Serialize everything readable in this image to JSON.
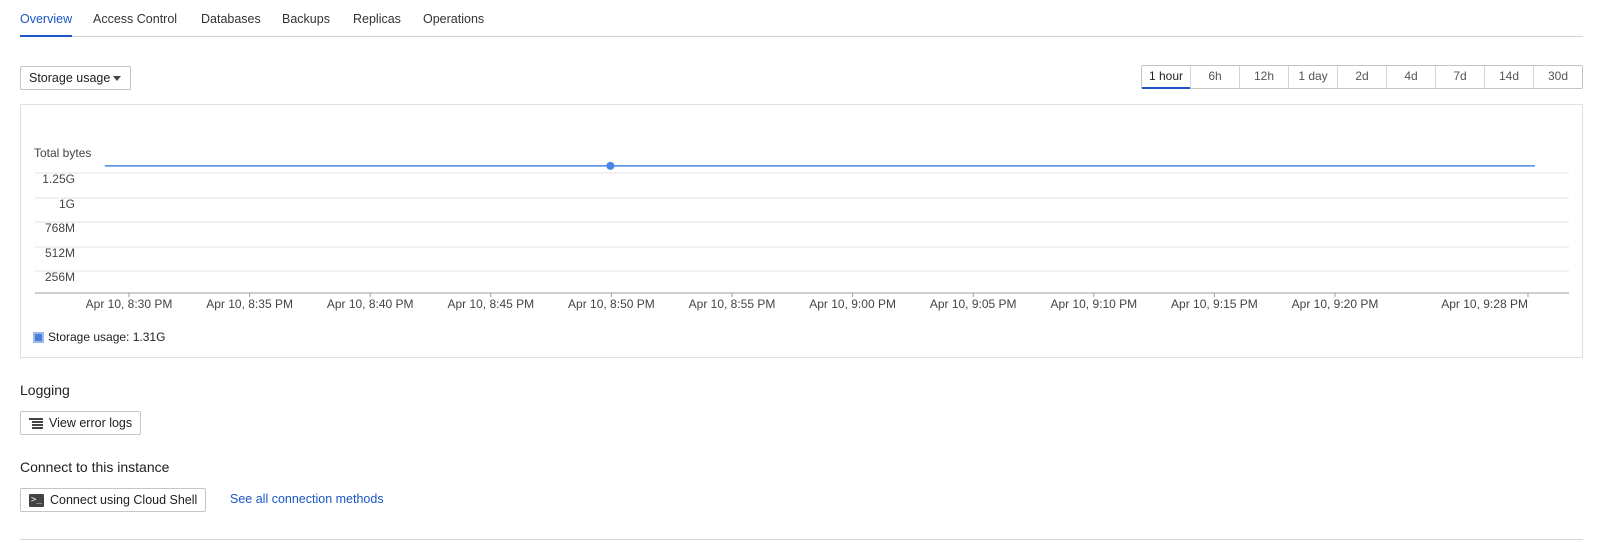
{
  "tabs": [
    {
      "label": "Overview",
      "active": true
    },
    {
      "label": "Access Control",
      "active": false
    },
    {
      "label": "Databases",
      "active": false
    },
    {
      "label": "Backups",
      "active": false
    },
    {
      "label": "Replicas",
      "active": false
    },
    {
      "label": "Operations",
      "active": false
    }
  ],
  "metric_select": {
    "value": "Storage usage"
  },
  "time_ranges": [
    {
      "label": "1 hour",
      "active": true
    },
    {
      "label": "6h",
      "active": false
    },
    {
      "label": "12h",
      "active": false
    },
    {
      "label": "1 day",
      "active": false
    },
    {
      "label": "2d",
      "active": false
    },
    {
      "label": "4d",
      "active": false
    },
    {
      "label": "7d",
      "active": false
    },
    {
      "label": "14d",
      "active": false
    },
    {
      "label": "30d",
      "active": false
    }
  ],
  "chart_data": {
    "type": "line",
    "ylabel": "Total bytes",
    "y_ticks": [
      "1.25G",
      "1G",
      "768M",
      "512M",
      "256M"
    ],
    "x_ticks": [
      "Apr 10, 8:30 PM",
      "Apr 10, 8:35 PM",
      "Apr 10, 8:40 PM",
      "Apr 10, 8:45 PM",
      "Apr 10, 8:50 PM",
      "Apr 10, 8:55 PM",
      "Apr 10, 9:00 PM",
      "Apr 10, 9:05 PM",
      "Apr 10, 9:10 PM",
      "Apr 10, 9:15 PM",
      "Apr 10, 9:20 PM",
      "Apr 10, 9:28 PM"
    ],
    "series": [
      {
        "name": "Storage usage",
        "value_label": "1.31G",
        "x_start_min": -1,
        "x_end_min": 58,
        "value_gb": 1.31,
        "highlight_min": 20,
        "color": "#4a86e8"
      }
    ],
    "ylim_gb": [
      0,
      1.35
    ],
    "grid": true,
    "legend": "bottom-left"
  },
  "legend": {
    "text": "Storage usage: 1.31G"
  },
  "logging": {
    "title": "Logging",
    "button": "View error logs"
  },
  "connect": {
    "title": "Connect to this instance",
    "button": "Connect using Cloud Shell",
    "link": "See all connection methods"
  },
  "colors": {
    "accent": "#1a56c4",
    "series": "#4a86e8"
  }
}
